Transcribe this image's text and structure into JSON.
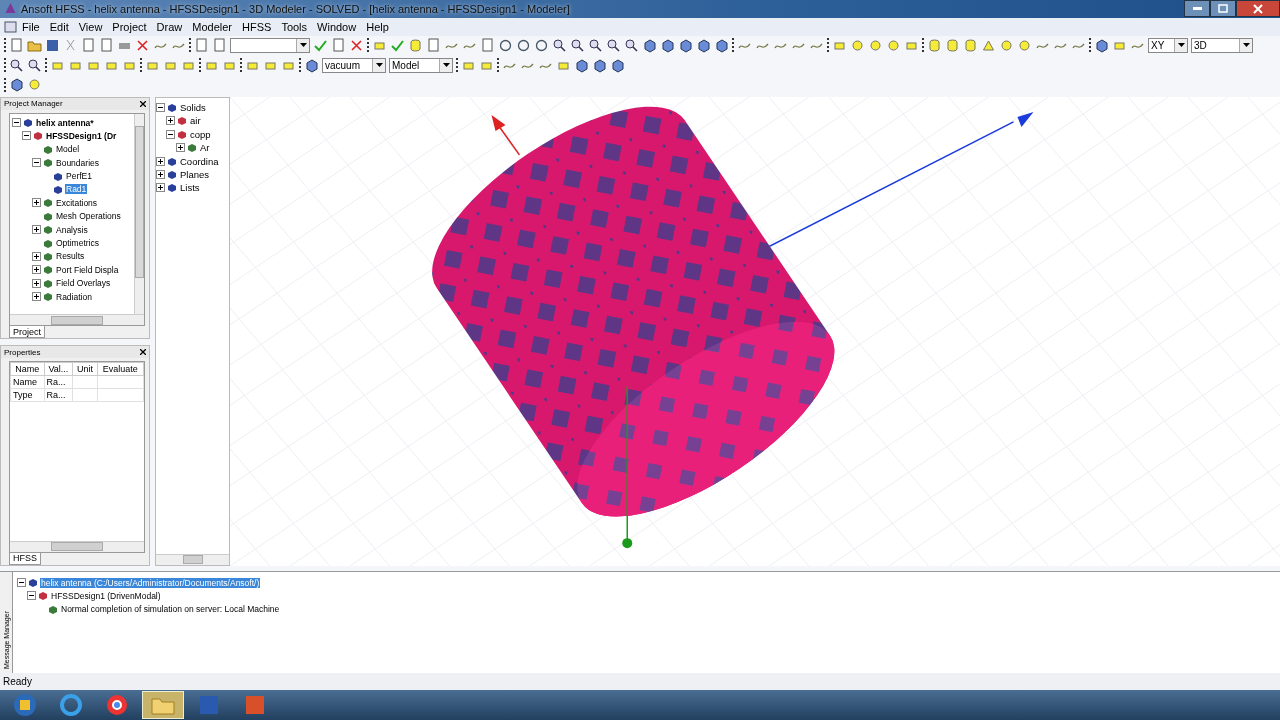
{
  "window": {
    "title": "Ansoft HFSS  - helix antenna - HFSSDesign1 - 3D Modeler - SOLVED - [helix antenna - HFSSDesign1 - Modeler]"
  },
  "menu": [
    "File",
    "Edit",
    "View",
    "Project",
    "Draw",
    "Modeler",
    "HFSS",
    "Tools",
    "Window",
    "Help"
  ],
  "toolbar": {
    "material": "vacuum",
    "mode": "Model",
    "plane": "XY",
    "view": "3D"
  },
  "project_manager": {
    "title": "Project Manager",
    "tab": "Project",
    "tree": [
      {
        "label": "helix antenna*",
        "bold": true,
        "expanded": true,
        "selected": false,
        "children": [
          {
            "label": "HFSSDesign1 (Dr",
            "bold": true,
            "expanded": true,
            "selected": false,
            "children": [
              {
                "label": "Model",
                "selected": false
              },
              {
                "label": "Boundaries",
                "expanded": true,
                "selected": false,
                "children": [
                  {
                    "label": "PerfE1",
                    "selected": false
                  },
                  {
                    "label": "Rad1",
                    "selected": true
                  }
                ]
              },
              {
                "label": "Excitations",
                "expanded": false,
                "selected": false
              },
              {
                "label": "Mesh Operations",
                "selected": false
              },
              {
                "label": "Analysis",
                "expanded": false,
                "selected": false
              },
              {
                "label": "Optimetrics",
                "selected": false
              },
              {
                "label": "Results",
                "expanded": false,
                "selected": false
              },
              {
                "label": "Port Field Displa",
                "expanded": false,
                "selected": false
              },
              {
                "label": "Field Overlays",
                "expanded": false,
                "selected": false
              },
              {
                "label": "Radiation",
                "expanded": false,
                "selected": false
              }
            ]
          }
        ]
      }
    ]
  },
  "properties": {
    "title": "Properties",
    "tab": "HFSS",
    "columns": [
      "Name",
      "Val...",
      "Unit",
      "Evaluate"
    ],
    "rows": [
      [
        "Name",
        "Ra...",
        "",
        ""
      ],
      [
        "Type",
        "Ra...",
        "",
        ""
      ]
    ]
  },
  "model_tree": [
    {
      "label": "Solids",
      "expanded": true,
      "children": [
        {
          "label": "air",
          "expanded": false
        },
        {
          "label": "copp",
          "expanded": true,
          "children": [
            {
              "label": "Ar",
              "expanded": false
            }
          ]
        }
      ]
    },
    {
      "label": "Coordina",
      "expanded": false
    },
    {
      "label": "Planes",
      "expanded": false
    },
    {
      "label": "Lists",
      "expanded": false
    }
  ],
  "message_manager": {
    "title": "Message Manager",
    "tree": [
      {
        "label": "helix antenna (C:/Users/Administrator/Documents/Ansoft/)",
        "selected": true,
        "expanded": true,
        "children": [
          {
            "label": "HFSSDesign1 (DrivenModal)",
            "selected": false,
            "expanded": true,
            "children": [
              {
                "label": "Normal completion of simulation on server: Local Machine",
                "selected": false
              }
            ]
          }
        ]
      }
    ]
  },
  "status_bar": "Ready"
}
